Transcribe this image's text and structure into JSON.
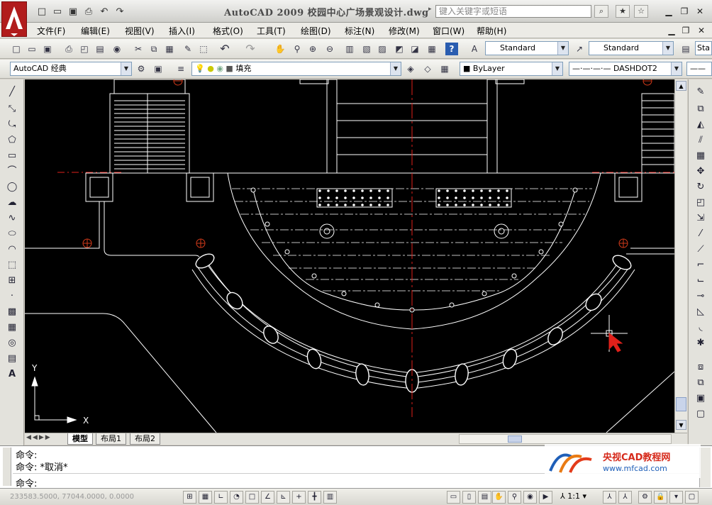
{
  "app": {
    "title": "AutoCAD 2009 校园中心广场景观设计.dwg",
    "search_placeholder": "键入关键字或短语",
    "logo_letter": "A"
  },
  "menu": [
    "文件(F)",
    "编辑(E)",
    "视图(V)",
    "插入(I)",
    "格式(O)",
    "工具(T)",
    "绘图(D)",
    "标注(N)",
    "修改(M)",
    "窗口(W)",
    "帮助(H)"
  ],
  "toolbar": {
    "text_style": "Standard",
    "dim_style": "Standard",
    "table_style": "Sta",
    "workspace": "AutoCAD 经典",
    "layer": "填充",
    "color": "ByLayer",
    "linetype": "DASHDOT2"
  },
  "canvas": {
    "ucs_x": "X",
    "ucs_y": "Y",
    "background": "#000000",
    "accent_red": "#e0201a",
    "line_color": "#ffffff"
  },
  "tabs": [
    "模型",
    "布局1",
    "布局2"
  ],
  "command": {
    "history_1": "命令:",
    "history_2": "命令: *取消*",
    "prompt": "命令:"
  },
  "status": {
    "coords": "233583.5000, 77044.0000, 0.0000",
    "annotation_scale": "1:1"
  },
  "watermark": {
    "title": "央视CAD教程网",
    "url": "www.mfcad.com"
  }
}
